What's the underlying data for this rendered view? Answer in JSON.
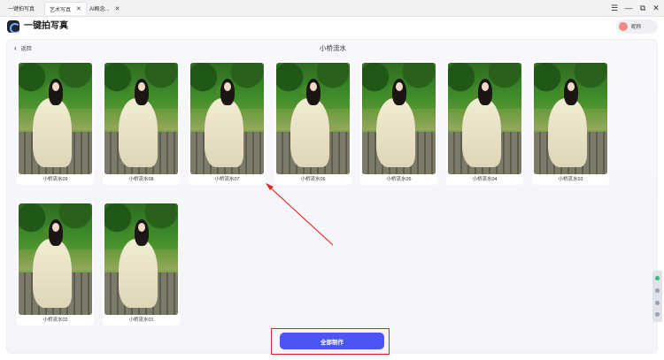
{
  "tabs": [
    {
      "label": "一键拍写真",
      "active": false
    },
    {
      "label": "艺术写真",
      "active": true
    },
    {
      "label": "AI概念...",
      "active": false
    }
  ],
  "window_controls": {
    "menu": "☰",
    "minimize": "—",
    "restore": "⧉",
    "close": "✕"
  },
  "app": {
    "title": "一键拍写真",
    "user_name": "昵称"
  },
  "page": {
    "back_label": "返回",
    "title": "小桥流水"
  },
  "gallery": [
    {
      "label": "小桥流水09"
    },
    {
      "label": "小桥流水08"
    },
    {
      "label": "小桥流水07"
    },
    {
      "label": "小桥流水06"
    },
    {
      "label": "小桥流水05"
    },
    {
      "label": "小桥流水04"
    },
    {
      "label": "小桥流水03"
    },
    {
      "label": "小桥流水02"
    },
    {
      "label": "小桥流水01"
    }
  ],
  "actions": {
    "make_all_label": "全部制作"
  },
  "colors": {
    "primary": "#4b56f2",
    "annotation": "#e02424"
  }
}
